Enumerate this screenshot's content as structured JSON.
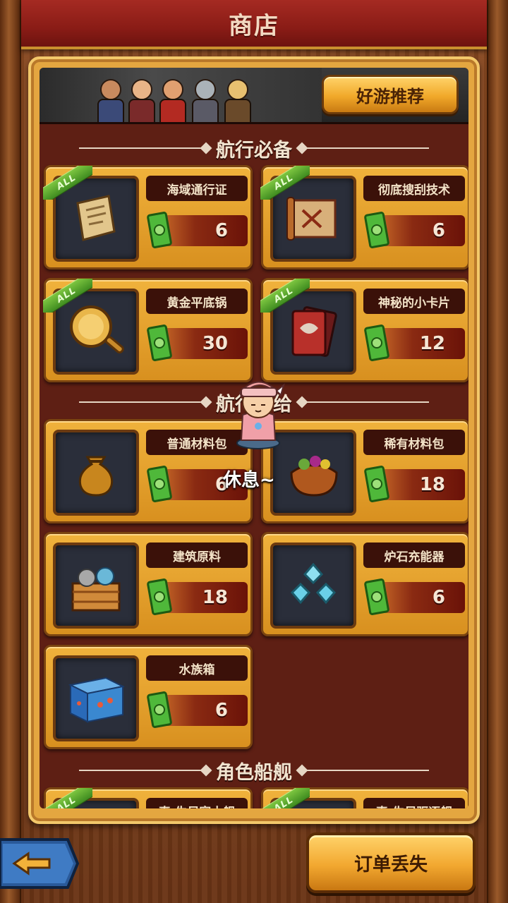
{
  "header": {
    "title": "商店"
  },
  "banner": {
    "recommend_label": "好游推荐"
  },
  "sections": [
    {
      "title": "航行必备",
      "items": [
        {
          "name": "海域通行证",
          "price": "6",
          "badge": "ALL",
          "icon": "scroll-map-icon"
        },
        {
          "name": "彻底搜刮技术",
          "price": "6",
          "badge": "ALL",
          "icon": "treasure-scroll-icon"
        },
        {
          "name": "黄金平底锅",
          "price": "30",
          "badge": "ALL",
          "icon": "frying-pan-icon"
        },
        {
          "name": "神秘的小卡片",
          "price": "12",
          "badge": "ALL",
          "icon": "dragon-card-icon"
        }
      ]
    },
    {
      "title": "航行补给",
      "items": [
        {
          "name": "普通材料包",
          "price": "6",
          "icon": "material-bag-icon"
        },
        {
          "name": "稀有材料包",
          "price": "18",
          "icon": "rare-bag-icon"
        },
        {
          "name": "建筑原料",
          "price": "18",
          "icon": "building-crate-icon"
        },
        {
          "name": "炉石充能器",
          "price": "6",
          "icon": "crystal-charger-icon"
        },
        {
          "name": "水族箱",
          "price": "6",
          "icon": "aquarium-icon"
        }
      ]
    },
    {
      "title": "角色船舰",
      "items": [
        {
          "name": "真·生尽容士舰",
          "badge": "ALL"
        },
        {
          "name": "真·生尽驱逐舰",
          "badge": "ALL"
        }
      ]
    }
  ],
  "overlay": {
    "rest_text": "休息~"
  },
  "footer": {
    "lost_order_label": "订单丢失"
  },
  "colors": {
    "title_bar": "#8a1c16",
    "panel_gold": "#e4a640",
    "panel_inner": "#5e1f14",
    "ribbon_green": "#5aa82e"
  }
}
